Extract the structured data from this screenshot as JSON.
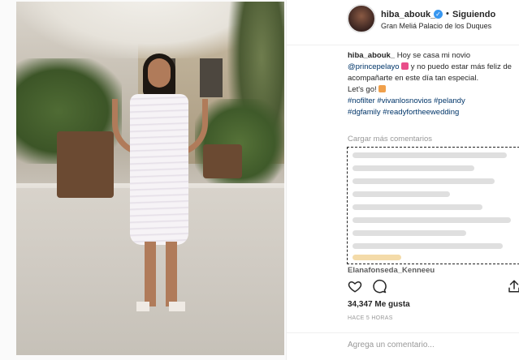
{
  "post": {
    "username": "hiba_abouk_",
    "follow_status": "Siguiendo",
    "separator": "•",
    "location": "Gran Meliá Palacio de los Duques",
    "caption": {
      "author": "hiba_abouk_",
      "text1": "Hoy se casa mi novio",
      "mention": "@princepelayo",
      "text2": "y no puedo estar más feliz de acompañarte en este día tan especial.",
      "text3": "Let's go!",
      "hashtags_line1": "#nofilter #vivanlosnovios #pelandy",
      "hashtags_line2": "#dgfamily #readyfortheewedding"
    },
    "load_more": "Cargar más comentarios",
    "partial_comment": "Elanafonseda_Kenneeu",
    "likes": "34,347 Me gusta",
    "time": "HACE 5 HORAS",
    "comment_placeholder": "Agrega un comentario..."
  },
  "icons": {
    "verified": "verified-badge-icon",
    "heart": "heart-icon",
    "comment": "comment-icon",
    "share": "share-icon"
  },
  "colors": {
    "link": "#003569",
    "verified": "#3897f0",
    "muted": "#999999"
  }
}
